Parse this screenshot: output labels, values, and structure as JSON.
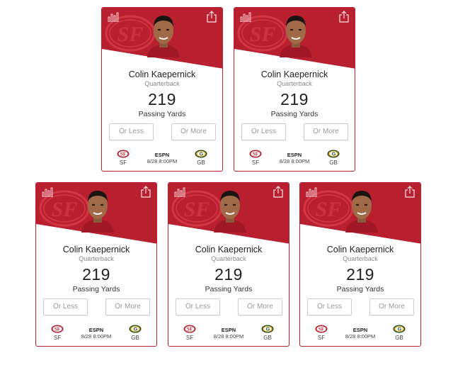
{
  "cards": [
    {
      "player_name": "Colin Kaepernick",
      "position": "Quarterback",
      "stat_value": "219",
      "stat_label": "Passing Yards",
      "less_label": "Or Less",
      "more_label": "Or More",
      "home_team": "SF",
      "away_team": "GB",
      "network": "ESPN",
      "datetime": "8/28 8:00PM"
    },
    {
      "player_name": "Colin Kaepernick",
      "position": "Quarterback",
      "stat_value": "219",
      "stat_label": "Passing Yards",
      "less_label": "Or Less",
      "more_label": "Or More",
      "home_team": "SF",
      "away_team": "GB",
      "network": "ESPN",
      "datetime": "8/28 8:00PM"
    },
    {
      "player_name": "Colin Kaepernick",
      "position": "Quarterback",
      "stat_value": "219",
      "stat_label": "Passing Yards",
      "less_label": "Or Less",
      "more_label": "Or More",
      "home_team": "SF",
      "away_team": "GB",
      "network": "ESPN",
      "datetime": "8/28 8:00PM"
    },
    {
      "player_name": "Colin Kaepernick",
      "position": "Quarterback",
      "stat_value": "219",
      "stat_label": "Passing Yards",
      "less_label": "Or Less",
      "more_label": "Or More",
      "home_team": "SF",
      "away_team": "GB",
      "network": "ESPN",
      "datetime": "8/28 8:00PM"
    },
    {
      "player_name": "Colin Kaepernick",
      "position": "Quarterback",
      "stat_value": "219",
      "stat_label": "Passing Yards",
      "less_label": "Or Less",
      "more_label": "Or More",
      "home_team": "SF",
      "away_team": "GB",
      "network": "ESPN",
      "datetime": "8/28 8:00PM"
    }
  ],
  "icons": {
    "stats": "bar-chart-icon",
    "share": "share-icon",
    "home_logo": "49ers-logo",
    "away_logo": "packers-logo"
  },
  "colors": {
    "team_red": "#b9202f",
    "team_red_light": "#d23644",
    "gb_green": "#1f4a2e",
    "gb_gold": "#f0b429"
  }
}
